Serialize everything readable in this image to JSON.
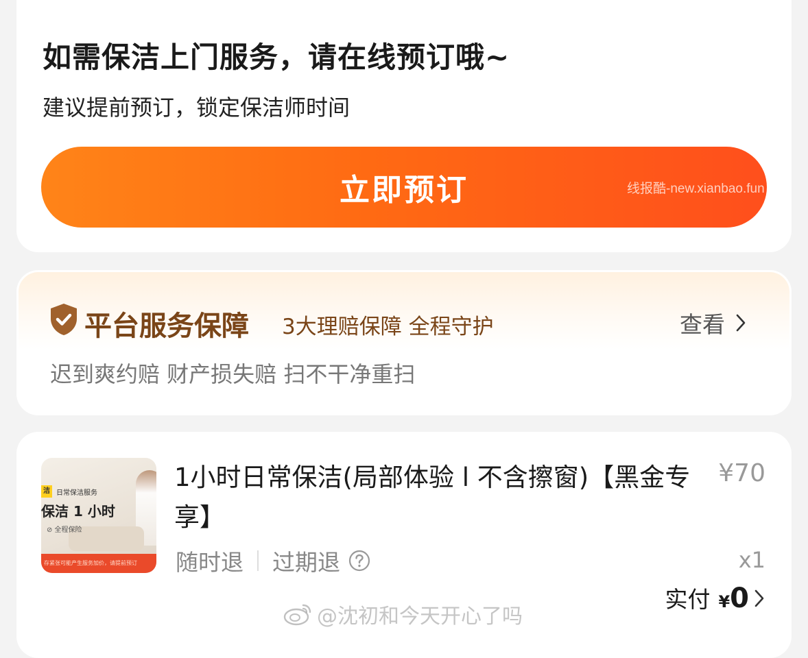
{
  "booking": {
    "title": "如需保洁上门服务，请在线预订哦~",
    "subtitle": "建议提前预订，锁定保洁师时间",
    "button_label": "立即预订",
    "watermark": "线报酷-new.xianbao.fun"
  },
  "guarantee": {
    "title": "平台服务保障",
    "subtitle": "3大理赔保障 全程守护",
    "view_label": "查看",
    "items": "迟到爽约赔 财产损失赔 扫不干净重扫",
    "accent_color": "#7a4518"
  },
  "order": {
    "thumbnail": {
      "tag_highlight": "洁",
      "tag_text": "日常保洁服务",
      "title": "保洁 1 小时",
      "badge": "⊘ 全程保险",
      "footer": "存紧张可能产生服务加价，请提前预订"
    },
    "title": "1小时日常保洁(局部体验 l 不含擦窗)【黑金专享】",
    "price": "¥70",
    "tag_refund_anytime": "随时退",
    "tag_refund_expired": "过期退",
    "quantity": "x1",
    "paid_label": "实付",
    "paid_currency": "¥",
    "paid_amount": "0"
  },
  "watermark_bottom": "@沈初和今天开心了吗",
  "icons": {
    "shield": "shield-check-icon",
    "chevron": "chevron-right-icon",
    "help": "question-circle-icon",
    "weibo": "weibo-logo-icon"
  },
  "colors": {
    "button_start": "#ff8418",
    "button_end": "#ff4f1c",
    "background": "#f3f3f3"
  }
}
